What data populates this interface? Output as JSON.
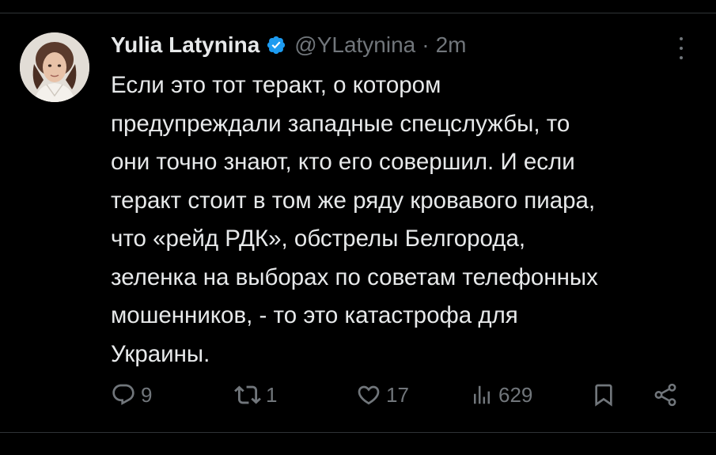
{
  "tweet": {
    "author": {
      "display_name": "Yulia Latynina",
      "handle": "@YLatynina",
      "verified": true
    },
    "separator": "·",
    "time": "2m",
    "lines": [
      "Если это тот теракт, о котором",
      "предупреждали западные спецслужбы, то",
      "они точно знают, кто его совершил. И если",
      "теракт стоит в том же ряду кровавого пиара,",
      "что «рейд РДК», обстрелы Белгорода,",
      "зеленка на выборах по советам телефонных",
      "мошенников, - то это катастрофа для",
      "Украины."
    ],
    "actions": {
      "replies": "9",
      "reposts": "1",
      "likes": "17",
      "views": "629"
    }
  },
  "icons": {
    "verified": "verified-badge-icon",
    "more": "more-options-icon",
    "reply": "reply-icon",
    "repost": "repost-icon",
    "like": "heart-icon",
    "views": "views-bar-chart-icon",
    "bookmark": "bookmark-icon",
    "share": "share-icon"
  },
  "colors": {
    "background": "#000000",
    "text": "#e7e9ea",
    "secondary": "#71767b",
    "verified": "#1d9bf0",
    "divider": "#2f3336"
  }
}
